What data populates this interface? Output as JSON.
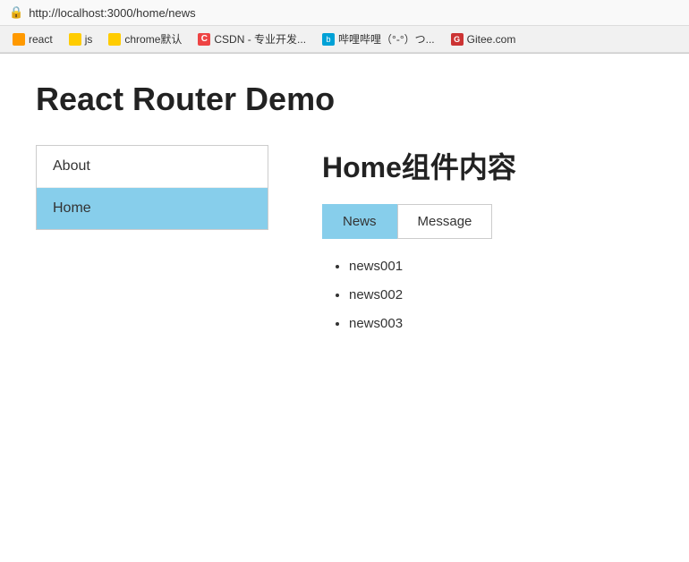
{
  "browser": {
    "url": "http://localhost:3000/home/news",
    "bookmarks": [
      {
        "label": "react",
        "iconColor": "orange",
        "iconType": "plain"
      },
      {
        "label": "js",
        "iconColor": "yellow",
        "iconType": "plain"
      },
      {
        "label": "chrome默认",
        "iconColor": "yellow",
        "iconType": "plain"
      },
      {
        "label": "CSDN - 专业开发...",
        "iconColor": "red-c",
        "iconType": "letter",
        "letter": "C"
      },
      {
        "label": "哔哩哔哩（°-°）つ...",
        "iconColor": "blue-bili",
        "iconType": "letter",
        "letter": "b"
      },
      {
        "label": "Gitee.com",
        "iconColor": "red-g",
        "iconType": "letter",
        "letter": "G"
      }
    ]
  },
  "page": {
    "title": "React Router Demo"
  },
  "left_nav": {
    "items": [
      {
        "label": "About",
        "active": false
      },
      {
        "label": "Home",
        "active": true
      }
    ]
  },
  "right_content": {
    "component_title": "Home组件内容",
    "tabs": [
      {
        "label": "News",
        "active": true
      },
      {
        "label": "Message",
        "active": false
      }
    ],
    "news_items": [
      "news001",
      "news002",
      "news003"
    ]
  }
}
